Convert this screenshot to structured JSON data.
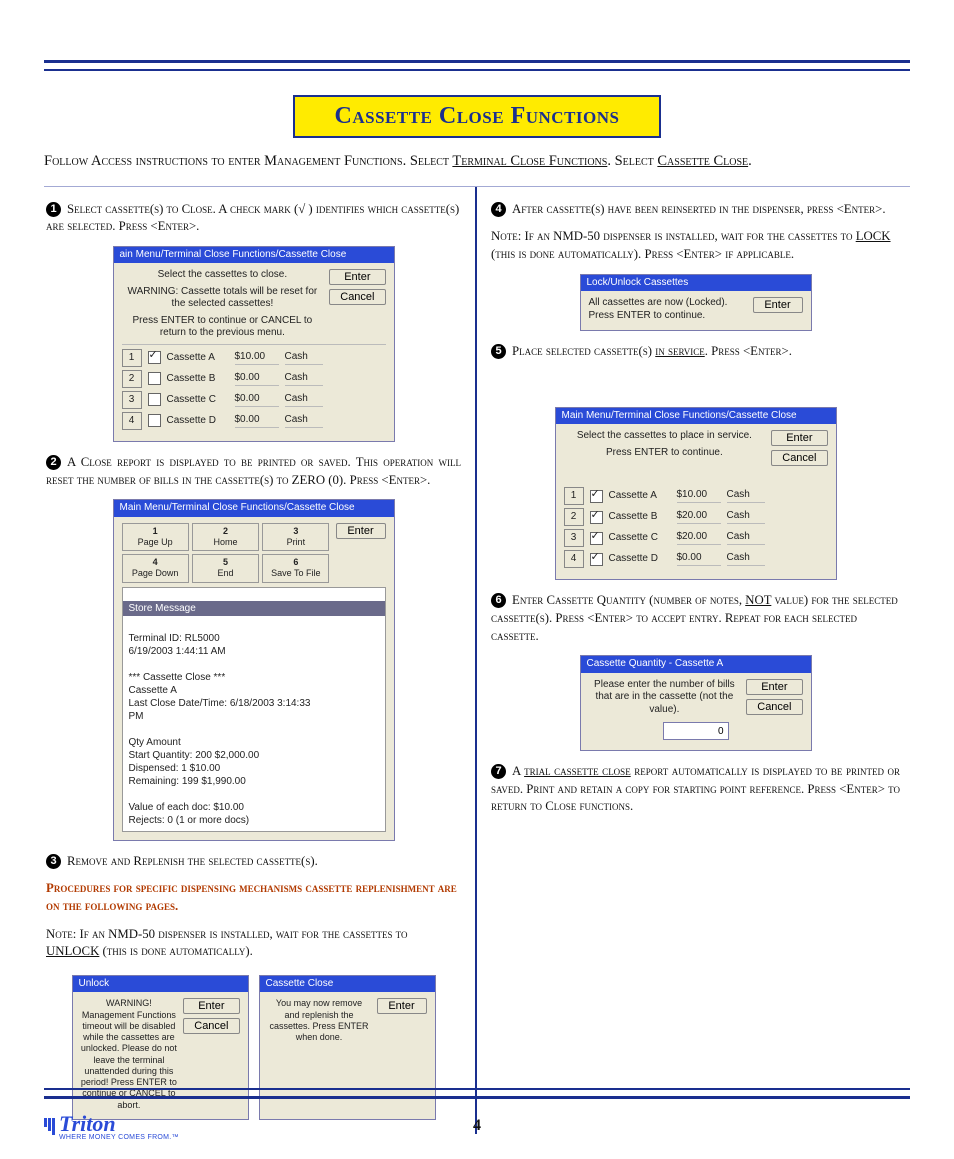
{
  "title": "Cassette Close Functions",
  "intro_a": "Follow Access instructions to enter Management Functions.  Select ",
  "intro_link1": "Terminal Close Functions",
  "intro_b": ". Select ",
  "intro_link2": "Cassette Close",
  "intro_c": ".",
  "page_number": "4",
  "logo_text": "Triton",
  "logo_tag": "WHERE MONEY COMES FROM.™",
  "steps": {
    "s1": "Select cassette(s) to Close.  A check mark  (√ ) identifies which cassette(s) are selected.  Press <Enter>.",
    "s2": "A Close report is displayed to be printed or saved. This operation will reset the number of bills in the cassette(s) to ZERO (0).  Press <Enter>.",
    "s3": "Remove and Replenish the selected cassette(s).",
    "s3_warn": "Procedures for specific dispensing mechanisms cassette replenishment are on the following pages.",
    "s3_note_a": "Note:  If an NMD-50 dispenser is installed, wait for the cassettes to ",
    "s3_note_u": "UNLOCK",
    "s3_note_b": " (this is done automatically).",
    "s4": "After cassette(s) have been reinserted in the dispenser, press <Enter>.",
    "s4_note_a": "Note:  If an NMD-50 dispenser is installed,  wait for the cassettes to ",
    "s4_note_u": "LOCK",
    "s4_note_b": " (this is done automatically).  Press <Enter> if applicable.",
    "s5_a": "Place selected cassette(s) ",
    "s5_u": "in service",
    "s5_b": ".  Press <Enter>.",
    "s6_a": "Enter Cassette Quantity (number of notes, ",
    "s6_u": "NOT",
    "s6_b": " value) for the selected cassette(s).  Press <Enter> to accept entry.  Repeat for each selected cassette.",
    "s7_a": "A ",
    "s7_u": "trial cassette close",
    "s7_b": " report automatically is displayed to be printed or saved.  Print and retain a copy for starting point reference.  Press <Enter> to return to Close functions."
  },
  "btn": {
    "enter": "Enter",
    "cancel": "Cancel"
  },
  "dlg1": {
    "title": "ain Menu/Terminal Close Functions/Cassette Close",
    "line1": "Select the cassettes to close.",
    "line2": "WARNING: Cassette totals will be reset for the selected cassettes!",
    "line3": "Press ENTER to continue or CANCEL to return to the previous menu.",
    "rows": [
      {
        "n": "1",
        "chk": true,
        "lbl": "Cassette A",
        "amt": "$10.00",
        "type": "Cash"
      },
      {
        "n": "2",
        "chk": false,
        "lbl": "Cassette B",
        "amt": "$0.00",
        "type": "Cash"
      },
      {
        "n": "3",
        "chk": false,
        "lbl": "Cassette C",
        "amt": "$0.00",
        "type": "Cash"
      },
      {
        "n": "4",
        "chk": false,
        "lbl": "Cassette D",
        "amt": "$0.00",
        "type": "Cash"
      }
    ]
  },
  "dlg2": {
    "title": "Main Menu/Terminal Close Functions/Cassette Close",
    "nav": [
      {
        "n": "1",
        "l": "Page Up"
      },
      {
        "n": "2",
        "l": "Home"
      },
      {
        "n": "3",
        "l": "Print"
      },
      {
        "n": "4",
        "l": "Page Down"
      },
      {
        "n": "5",
        "l": "End"
      },
      {
        "n": "6",
        "l": "Save To File"
      }
    ],
    "store_hdr": "Store Message",
    "store": "Terminal ID: RL5000\n6/19/2003 1:44:11 AM\n\n*** Cassette Close ***\nCassette A\nLast Close Date/Time: 6/18/2003 3:14:33\nPM\n\n                      Qty     Amount\n    Start Quantity:  200   $2,000.00\n         Dispensed:    1      $10.00\n         Remaining:  199   $1,990.00\n\nValue of each doc: $10.00\nRejects: 0 (1 or more docs)"
  },
  "dlg3a": {
    "title": "Unlock",
    "msg": "WARNING! Management Functions timeout will be disabled while the cassettes are unlocked. Please do not leave the terminal unattended during this period!  Press ENTER to continue or CANCEL to abort."
  },
  "dlg3b": {
    "title": "Cassette Close",
    "msg": "You may now remove and replenish the cassettes.  Press ENTER when done."
  },
  "dlg4": {
    "title": "Lock/Unlock Cassettes",
    "msg": "All cassettes are now (Locked). Press ENTER to continue."
  },
  "dlg5": {
    "title": "Main Menu/Terminal Close Functions/Cassette Close",
    "line1": "Select the cassettes to place in service.",
    "line2": "Press ENTER to continue.",
    "rows": [
      {
        "n": "1",
        "chk": true,
        "lbl": "Cassette A",
        "amt": "$10.00",
        "type": "Cash"
      },
      {
        "n": "2",
        "chk": true,
        "lbl": "Cassette B",
        "amt": "$20.00",
        "type": "Cash"
      },
      {
        "n": "3",
        "chk": true,
        "lbl": "Cassette C",
        "amt": "$20.00",
        "type": "Cash"
      },
      {
        "n": "4",
        "chk": true,
        "lbl": "Cassette D",
        "amt": "$0.00",
        "type": "Cash"
      }
    ]
  },
  "dlg6": {
    "title": "Cassette Quantity - Cassette A",
    "msg": "Please enter the number of bills that are in the cassette (not the value).",
    "val": "0"
  }
}
